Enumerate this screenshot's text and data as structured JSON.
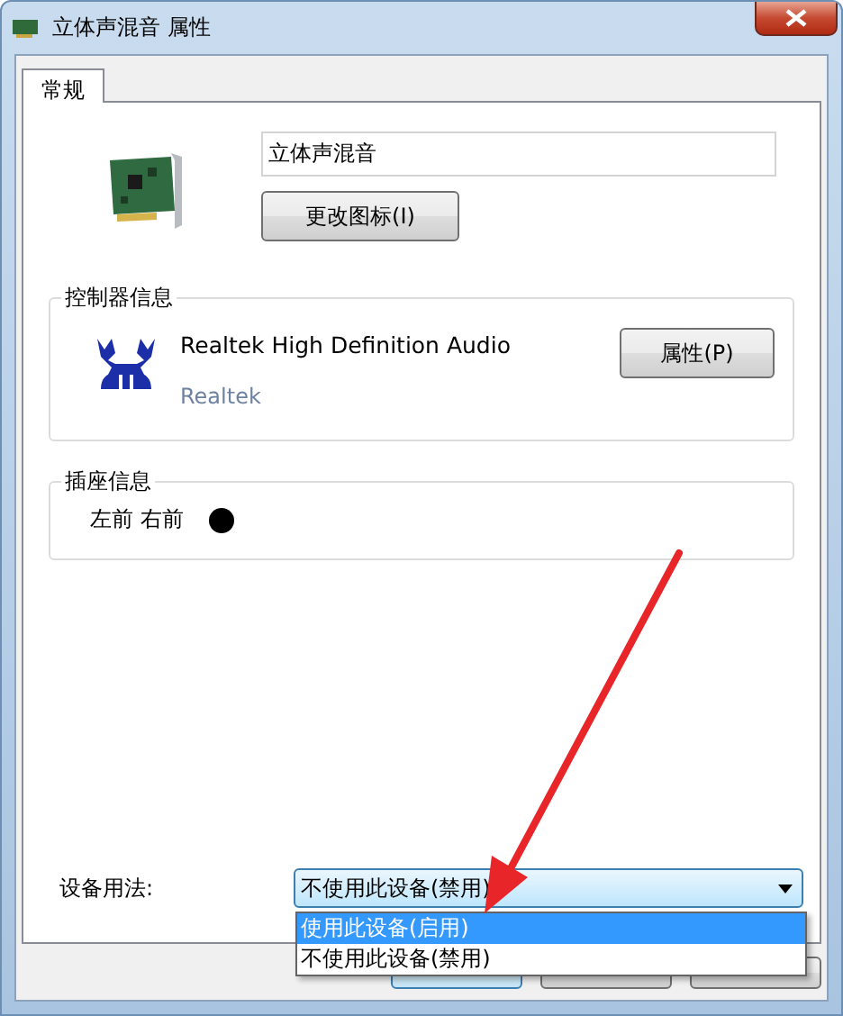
{
  "window": {
    "title": "立体声混音 属性"
  },
  "tabs": [
    {
      "label": "常规",
      "selected": true
    }
  ],
  "device": {
    "name": "立体声混音",
    "change_icon_button": "更改图标(I)"
  },
  "controller_group": {
    "title": "控制器信息",
    "name": "Realtek High Definition Audio",
    "vendor": "Realtek",
    "properties_button": "属性(P)"
  },
  "jack_group": {
    "title": "插座信息",
    "jacks": [
      {
        "label": "左前 右前",
        "color": "#000000"
      }
    ]
  },
  "device_usage": {
    "label": "设备用法:",
    "value": "不使用此设备(禁用)",
    "expanded": true,
    "options": [
      {
        "label": "使用此设备(启用)",
        "highlighted": true
      },
      {
        "label": "不使用此设备(禁用)",
        "highlighted": false
      }
    ]
  },
  "footer_buttons": [
    {
      "default": true
    },
    {
      "default": false
    },
    {
      "default": false
    }
  ]
}
